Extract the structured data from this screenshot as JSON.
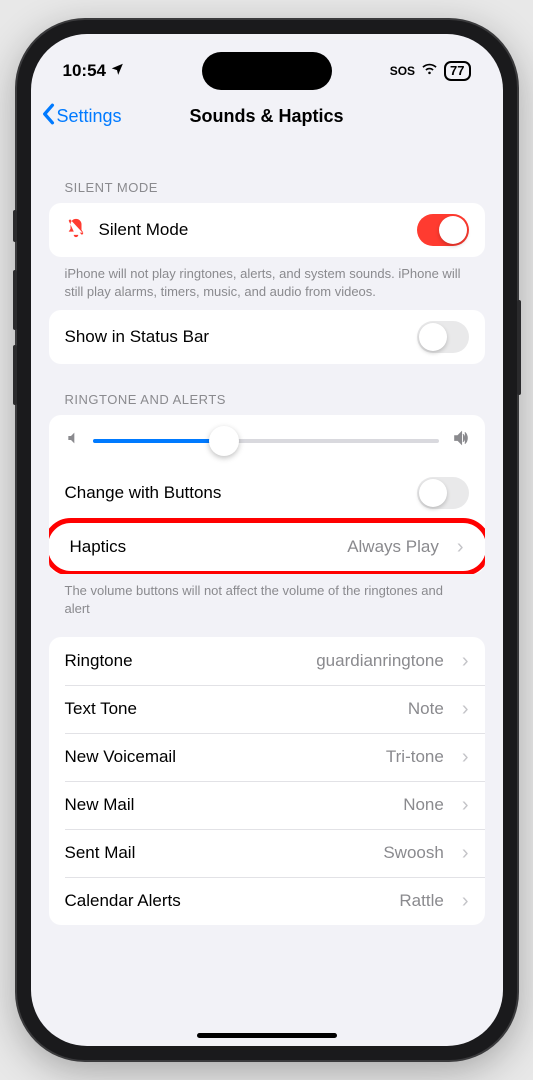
{
  "status": {
    "time": "10:54",
    "sos": "SOS",
    "battery": "77"
  },
  "nav": {
    "back": "Settings",
    "title": "Sounds & Haptics"
  },
  "silent": {
    "header": "SILENT MODE",
    "label": "Silent Mode",
    "note": "iPhone will not play ringtones, alerts, and system sounds. iPhone will still play alarms, timers, music, and audio from videos.",
    "statusbar_label": "Show in Status Bar"
  },
  "ringtone_alerts": {
    "header": "RINGTONE AND ALERTS",
    "change_buttons": "Change with Buttons",
    "haptics_label": "Haptics",
    "haptics_value": "Always Play",
    "note": "The volume buttons will not affect the volume of the ringtones and alert"
  },
  "sounds": {
    "ringtone_label": "Ringtone",
    "ringtone_value": "guardianringtone",
    "texttone_label": "Text Tone",
    "texttone_value": "Note",
    "voicemail_label": "New Voicemail",
    "voicemail_value": "Tri-tone",
    "newmail_label": "New Mail",
    "newmail_value": "None",
    "sentmail_label": "Sent Mail",
    "sentmail_value": "Swoosh",
    "calendar_label": "Calendar Alerts",
    "calendar_value": "Rattle"
  }
}
